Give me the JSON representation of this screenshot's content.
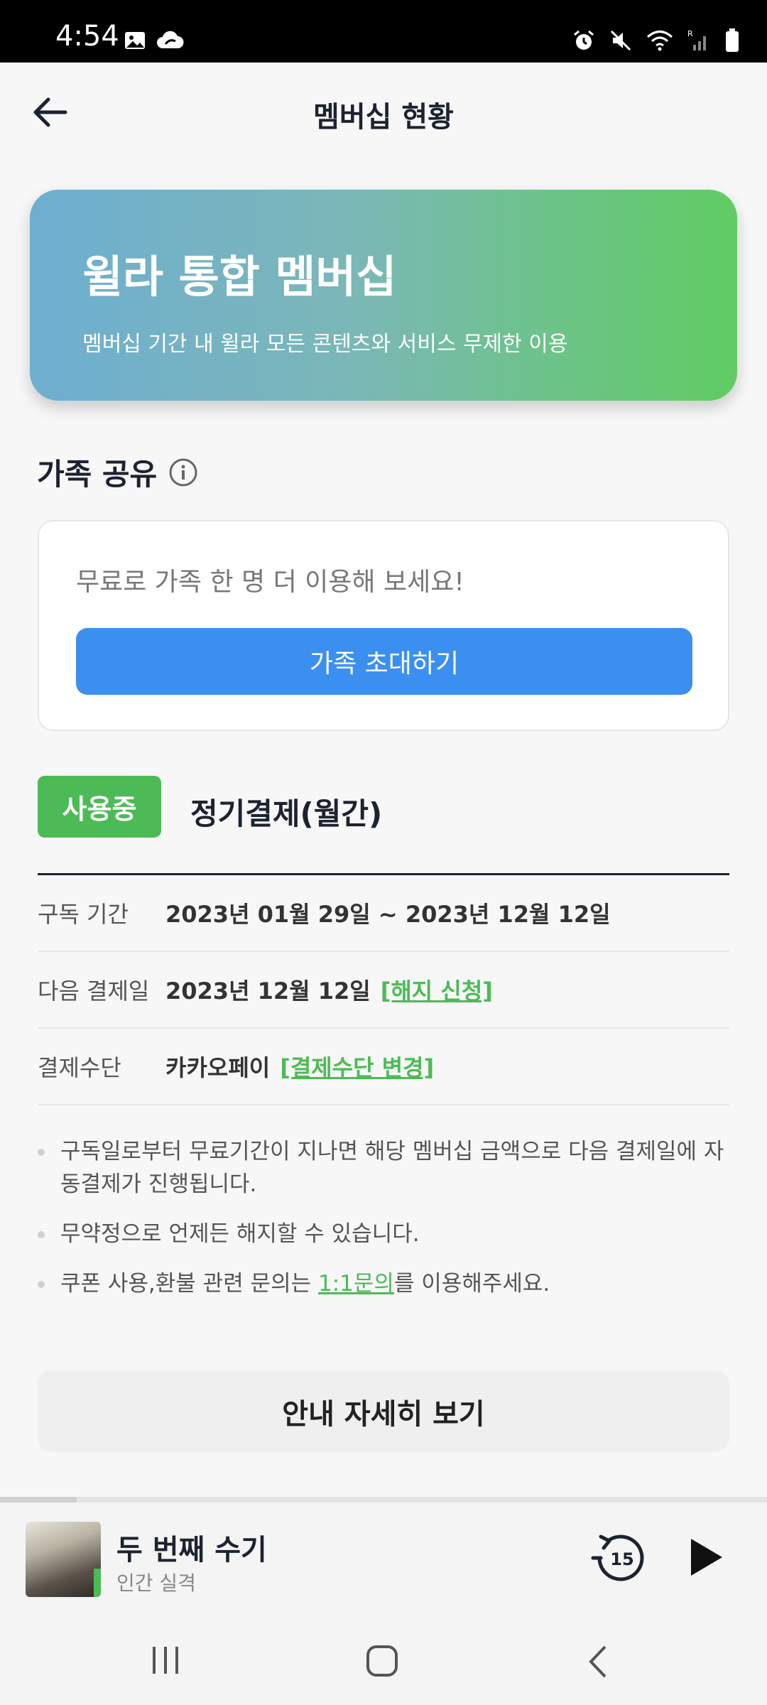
{
  "status_bar": {
    "time": "4:54"
  },
  "header": {
    "title": "멤버십 현황"
  },
  "hero": {
    "title": "윌라 통합 멤버십",
    "subtitle": "멤버십 기간 내 윌라 모든 콘텐츠와 서비스 무제한 이용"
  },
  "family": {
    "section_title": "가족 공유",
    "promo_text": "무료로 가족 한 명 더 이용해 보세요!",
    "invite_label": "가족 초대하기"
  },
  "subscription": {
    "status_badge": "사용중",
    "plan_name": "정기결제(월간)",
    "rows": [
      {
        "label": "구독 기간",
        "value": "2023년 01월 29일 ~ 2023년 12월 12일",
        "link": ""
      },
      {
        "label": "다음 결제일",
        "value": "2023년 12월 12일",
        "link": "[해지 신청]"
      },
      {
        "label": "결제수단",
        "value": "카카오페이",
        "link": "[결제수단 변경]"
      }
    ]
  },
  "notes": {
    "items": [
      "구독일로부터 무료기간이 지나면 해당 멤버십 금액으로 다음 결제일에 자동결제가 진행됩니다.",
      "무약정으로 언제든 해지할 수 있습니다."
    ],
    "coupon_prefix": "쿠폰 사용,환불 관련 문의는 ",
    "coupon_link": "1:1문의",
    "coupon_suffix": "를 이용해주세요."
  },
  "detail_button": "안내 자세히 보기",
  "player": {
    "title": "두 번째 수기",
    "subtitle": "인간 실격",
    "rewind_seconds": "15",
    "progress": 0.1
  },
  "colors": {
    "accent_green": "#4cbb55",
    "accent_blue": "#3b8ff0",
    "title_dark": "#1d2230"
  }
}
